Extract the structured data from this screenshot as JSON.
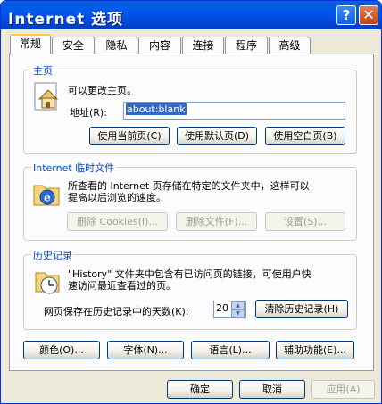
{
  "window": {
    "title": "Internet 选项",
    "help_glyph": "?",
    "close_glyph": "✕"
  },
  "tabs": [
    {
      "label": "常规",
      "active": true
    },
    {
      "label": "安全"
    },
    {
      "label": "隐私"
    },
    {
      "label": "内容"
    },
    {
      "label": "连接"
    },
    {
      "label": "程序"
    },
    {
      "label": "高级"
    }
  ],
  "home": {
    "legend": "主页",
    "description": "可以更改主页。",
    "address_label": "地址(R):",
    "address_value": "about:blank",
    "buttons": {
      "current": "使用当前页(C)",
      "default": "使用默认页(D)",
      "blank": "使用空白页(B)"
    }
  },
  "temp_files": {
    "legend": "Internet 临时文件",
    "description_line1": "所查看的 Internet 页存储在特定的文件夹中，这样可以",
    "description_line2": "提高以后浏览的速度。",
    "buttons": {
      "delete_cookies": "删除 Cookies(I)...",
      "delete_files": "删除文件(F)...",
      "settings": "设置(S)..."
    }
  },
  "history": {
    "legend": "历史记录",
    "description_line1": "\"History\" 文件夹中包含有已访问页的链接，可使用户快",
    "description_line2": "速访问最近查看过的页。",
    "days_label": "网页保存在历史记录中的天数(K):",
    "days_value": "20",
    "clear_button": "清除历史记录(H)"
  },
  "bottom_buttons": {
    "colors": "颜色(O)...",
    "fonts": "字体(N)...",
    "languages": "语言(L)...",
    "accessibility": "辅助功能(E)..."
  },
  "dialog_buttons": {
    "ok": "确定",
    "cancel": "取消",
    "apply": "应用(A)"
  },
  "colors": {
    "titlebar": "#0058EE",
    "accent": "#0046D5",
    "face": "#ECE9D8",
    "tab_highlight": "#FFC83C",
    "selection": "#316AC5"
  }
}
